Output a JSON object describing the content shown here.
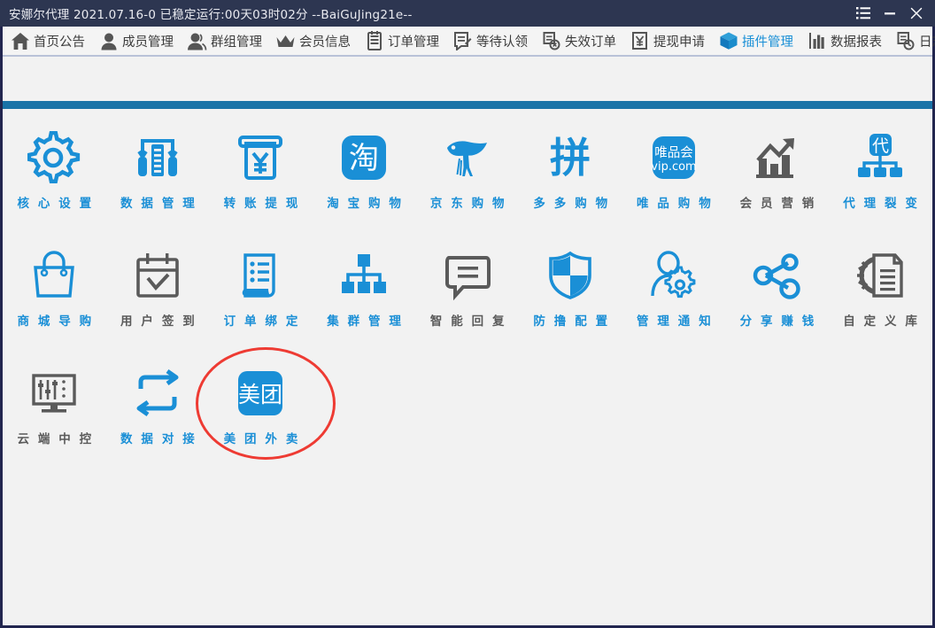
{
  "window": {
    "title": "安娜尔代理  2021.07.16-0 已稳定运行:00天03时02分   --BaiGuJing21e--",
    "controls": [
      {
        "name": "menu-button",
        "icon": "list-icon"
      },
      {
        "name": "minimize-button",
        "icon": "minimize-icon"
      },
      {
        "name": "close-button",
        "icon": "close-icon"
      }
    ],
    "titlebar_bg": "#2d3651",
    "border_color": "#22264f"
  },
  "toolbar": {
    "active_index": 8,
    "active_color": "#1a8fd6",
    "inactive_color": "#3c3c3c",
    "items": [
      {
        "label": "首页公告",
        "icon": "home-icon"
      },
      {
        "label": "成员管理",
        "icon": "user-icon"
      },
      {
        "label": "群组管理",
        "icon": "group-icon"
      },
      {
        "label": "会员信息",
        "icon": "crown-icon"
      },
      {
        "label": "订单管理",
        "icon": "clipboard-icon"
      },
      {
        "label": "等待认领",
        "icon": "document-pen-icon"
      },
      {
        "label": "失效订单",
        "icon": "document-x-icon"
      },
      {
        "label": "提现申请",
        "icon": "yuan-note-icon"
      },
      {
        "label": "插件管理",
        "icon": "cube-icon"
      },
      {
        "label": "数据报表",
        "icon": "bar-chart-icon"
      },
      {
        "label": "日志信息",
        "icon": "document-clock-icon"
      }
    ]
  },
  "divider": {
    "color": "#1a73a7"
  },
  "plugins": {
    "accent_color": "#1a8fd6",
    "disabled_color": "#5a5a5a",
    "rows": [
      [
        {
          "label": "核 心 设 置",
          "icon": "gear-icon",
          "state": "active"
        },
        {
          "label": "数 据 管 理",
          "icon": "data-mgmt-icon",
          "state": "active"
        },
        {
          "label": "转 账 提 现",
          "icon": "atm-yuan-icon",
          "state": "active"
        },
        {
          "label": "淘 宝 购 物",
          "icon": "taobao-icon",
          "state": "active"
        },
        {
          "label": "京 东 购 物",
          "icon": "jd-dog-icon",
          "state": "active"
        },
        {
          "label": "多 多 购 物",
          "icon": "pinduoduo-icon",
          "state": "active"
        },
        {
          "label": "唯 品 购 物",
          "icon": "vip-com-icon",
          "state": "active"
        },
        {
          "label": "会 员 营 销",
          "icon": "growth-chart-icon",
          "state": "disabled"
        },
        {
          "label": "代 理 裂 变",
          "icon": "agent-split-icon",
          "state": "active"
        }
      ],
      [
        {
          "label": "商 城 导 购",
          "icon": "shopping-bag-icon",
          "state": "active"
        },
        {
          "label": "用 户 签 到",
          "icon": "calendar-check-icon",
          "state": "disabled"
        },
        {
          "label": "订 单 绑 定",
          "icon": "order-scroll-icon",
          "state": "active"
        },
        {
          "label": "集 群 管 理",
          "icon": "sitemap-icon",
          "state": "active"
        },
        {
          "label": "智 能 回 复",
          "icon": "chat-bubble-icon",
          "state": "disabled"
        },
        {
          "label": "防 撸 配 置",
          "icon": "shield-icon",
          "state": "active"
        },
        {
          "label": "管 理 通 知",
          "icon": "user-gear-icon",
          "state": "active"
        },
        {
          "label": "分 享 赚 钱",
          "icon": "share-icon",
          "state": "active"
        },
        {
          "label": "自 定 义 库",
          "icon": "gear-document-icon",
          "state": "disabled"
        }
      ],
      [
        {
          "label": "云 端 中 控",
          "icon": "control-panel-icon",
          "state": "disabled"
        },
        {
          "label": "数 据 对 接",
          "icon": "sync-loop-icon",
          "state": "active"
        },
        {
          "label": "美 团 外 卖",
          "icon": "meituan-icon",
          "state": "active"
        }
      ]
    ]
  },
  "highlight": {
    "target_label": "美 团 外 卖",
    "shape": "ellipse",
    "color": "#ee3b33"
  }
}
